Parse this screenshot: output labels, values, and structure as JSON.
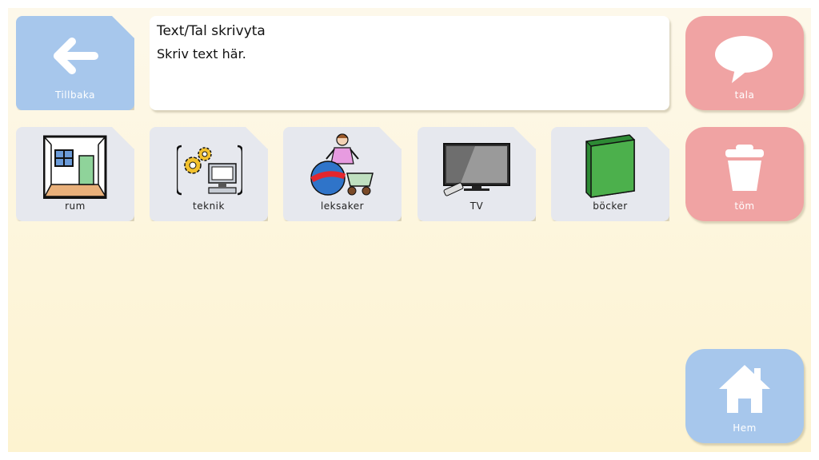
{
  "back_button": {
    "label": "Tillbaka",
    "icon": "arrow-left-icon"
  },
  "text_area": {
    "title": "Text/Tal skrivyta",
    "placeholder": "Skriv text här."
  },
  "categories": [
    {
      "label": "rum",
      "icon": "room-icon"
    },
    {
      "label": "teknik",
      "icon": "technology-icon"
    },
    {
      "label": "leksaker",
      "icon": "toys-icon"
    },
    {
      "label": "TV",
      "icon": "tv-icon"
    },
    {
      "label": "böcker",
      "icon": "book-icon"
    }
  ],
  "actions": {
    "speak": {
      "label": "tala",
      "icon": "speech-bubble-icon"
    },
    "clear": {
      "label": "töm",
      "icon": "trash-icon"
    },
    "home": {
      "label": "Hem",
      "icon": "home-icon"
    }
  },
  "colors": {
    "background": "#fdf6dc",
    "back_button": "#a7c7ec",
    "category_tile": "#e6e8ee",
    "action_pink": "#f0a3a3",
    "home_blue": "#a7c7ec"
  }
}
